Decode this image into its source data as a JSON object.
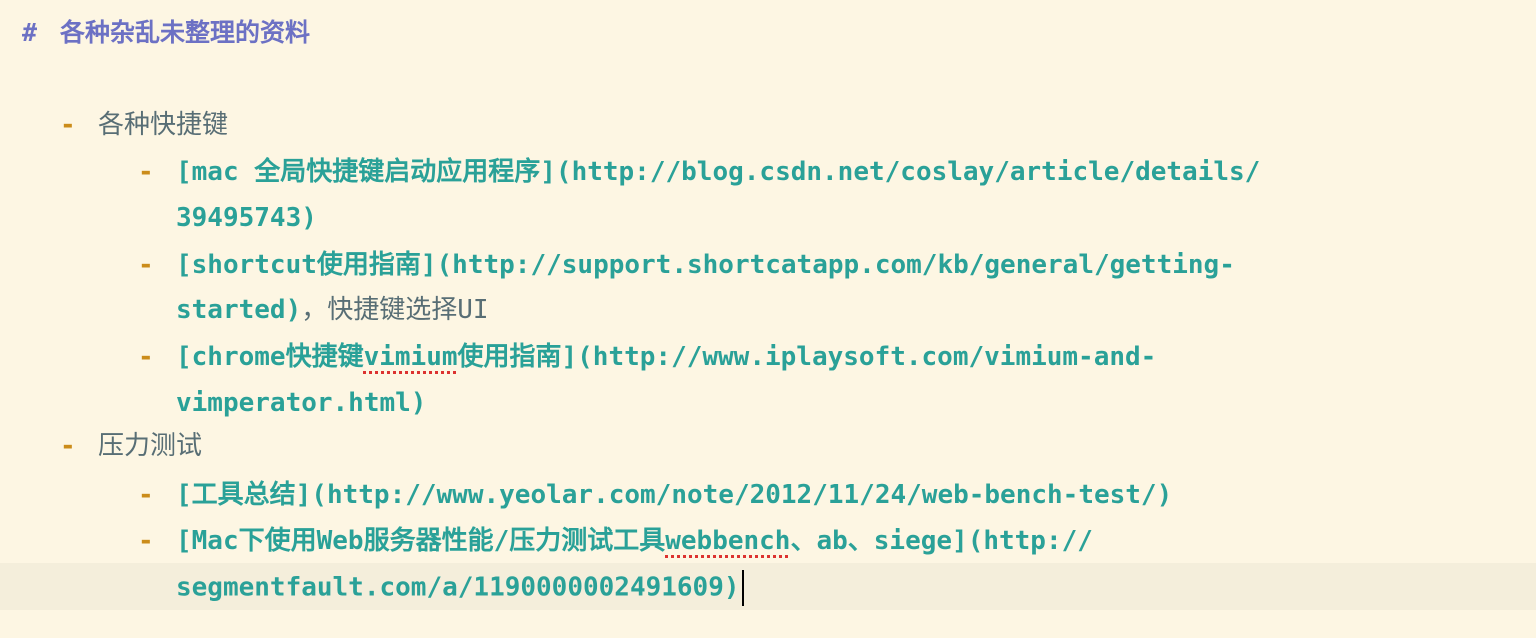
{
  "colors": {
    "background": "#fdf6e3",
    "current_line": "#f4eedb",
    "heading": "#6c71c4",
    "bullet": "#cb8c1a",
    "link": "#2aa198",
    "text": "#586e75",
    "spellcheck_underline": "#dc322f"
  },
  "document": {
    "heading_marker": "#",
    "heading_text": "各种杂乱未整理的资料",
    "bullet": "-",
    "sections": [
      {
        "title": "各种快捷键",
        "items": [
          {
            "line1": "[mac 全局快捷键启动应用程序](http://blog.csdn.net/coslay/article/details/",
            "line2": "39495743)"
          },
          {
            "line1": "[shortcut使用指南](http://support.shortcatapp.com/kb/general/getting-",
            "line2_link": "started)",
            "line2_text": "，快捷键选择UI"
          },
          {
            "line1_pre": "[chrome快捷键",
            "line1_misspelled": "vimium",
            "line1_post": "使用指南](http://www.iplaysoft.com/vimium-and-",
            "line2": "vimperator.html)"
          }
        ]
      },
      {
        "title": "压力测试",
        "items": [
          {
            "line1": "[工具总结](http://www.yeolar.com/note/2012/11/24/web-bench-test/)"
          },
          {
            "line1_pre": "[Mac下使用Web服务器性能/压力测试工具",
            "line1_misspelled": "webbench",
            "line1_post": "、ab、siege](http://",
            "line2": "segmentfault.com/a/1190000002491609)"
          }
        ]
      }
    ]
  }
}
